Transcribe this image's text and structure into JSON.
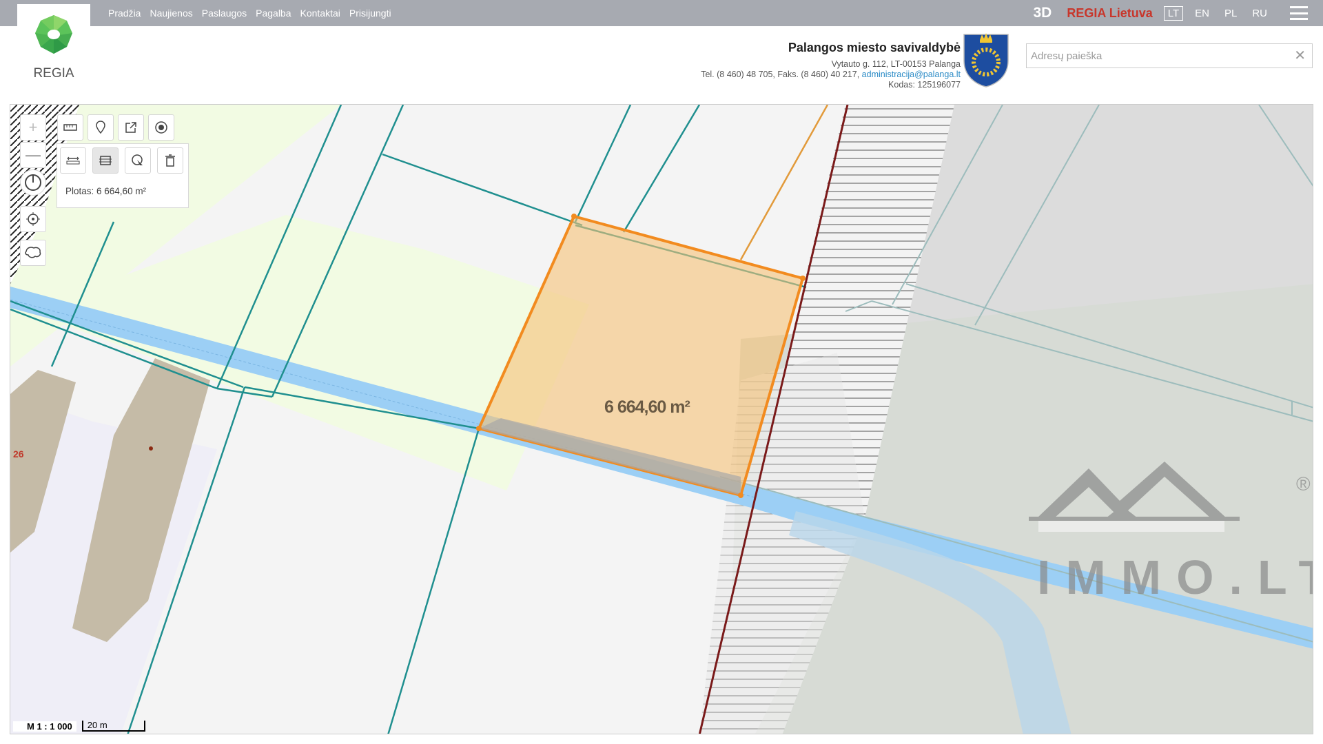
{
  "nav": {
    "items": [
      "Pradžia",
      "Naujienos",
      "Paslaugos",
      "Pagalba",
      "Kontaktai",
      "Prisijungti"
    ]
  },
  "topbar": {
    "btn_3d": "3D",
    "regia_lietuva": "REGIA Lietuva",
    "languages": [
      "LT",
      "EN",
      "PL",
      "RU"
    ],
    "active_language": "LT"
  },
  "logo": {
    "text": "REGIA"
  },
  "municipality": {
    "name": "Palangos miesto savivaldybė",
    "address": "Vytauto g. 112, LT-00153 Palanga",
    "phone": "Tel. (8 460) 48 705, Faks. (8 460) 40 217,",
    "email": "administracija@palanga.lt",
    "code": "Kodas: 125196077"
  },
  "search": {
    "placeholder": "Adresų paieška",
    "value": ""
  },
  "map": {
    "area_panel_label": "Plotas: 6 664,60 m²",
    "area_on_map": "6 664,60 m²",
    "plot_label": "26",
    "scale_ratio": "M 1 : 1 000",
    "scale_bar": "20 m",
    "watermark": "IMMO.LT",
    "registered_mark": "®"
  },
  "colors": {
    "topbar": "#a7aab1",
    "regia_red": "#c8362b",
    "parcel_line": "#1f8f8f",
    "measure_orange": "#f28b1f",
    "water_blue": "#9ccff5",
    "zone_green": "#f2fbe3"
  },
  "icons": [
    "zoom-in-icon",
    "zoom-out-icon",
    "compass-icon",
    "locate-icon",
    "region-icon",
    "ruler-icon",
    "pin-icon",
    "share-icon",
    "target-icon",
    "measure-distance-icon",
    "measure-area-icon",
    "select-measure-icon",
    "trash-icon"
  ]
}
